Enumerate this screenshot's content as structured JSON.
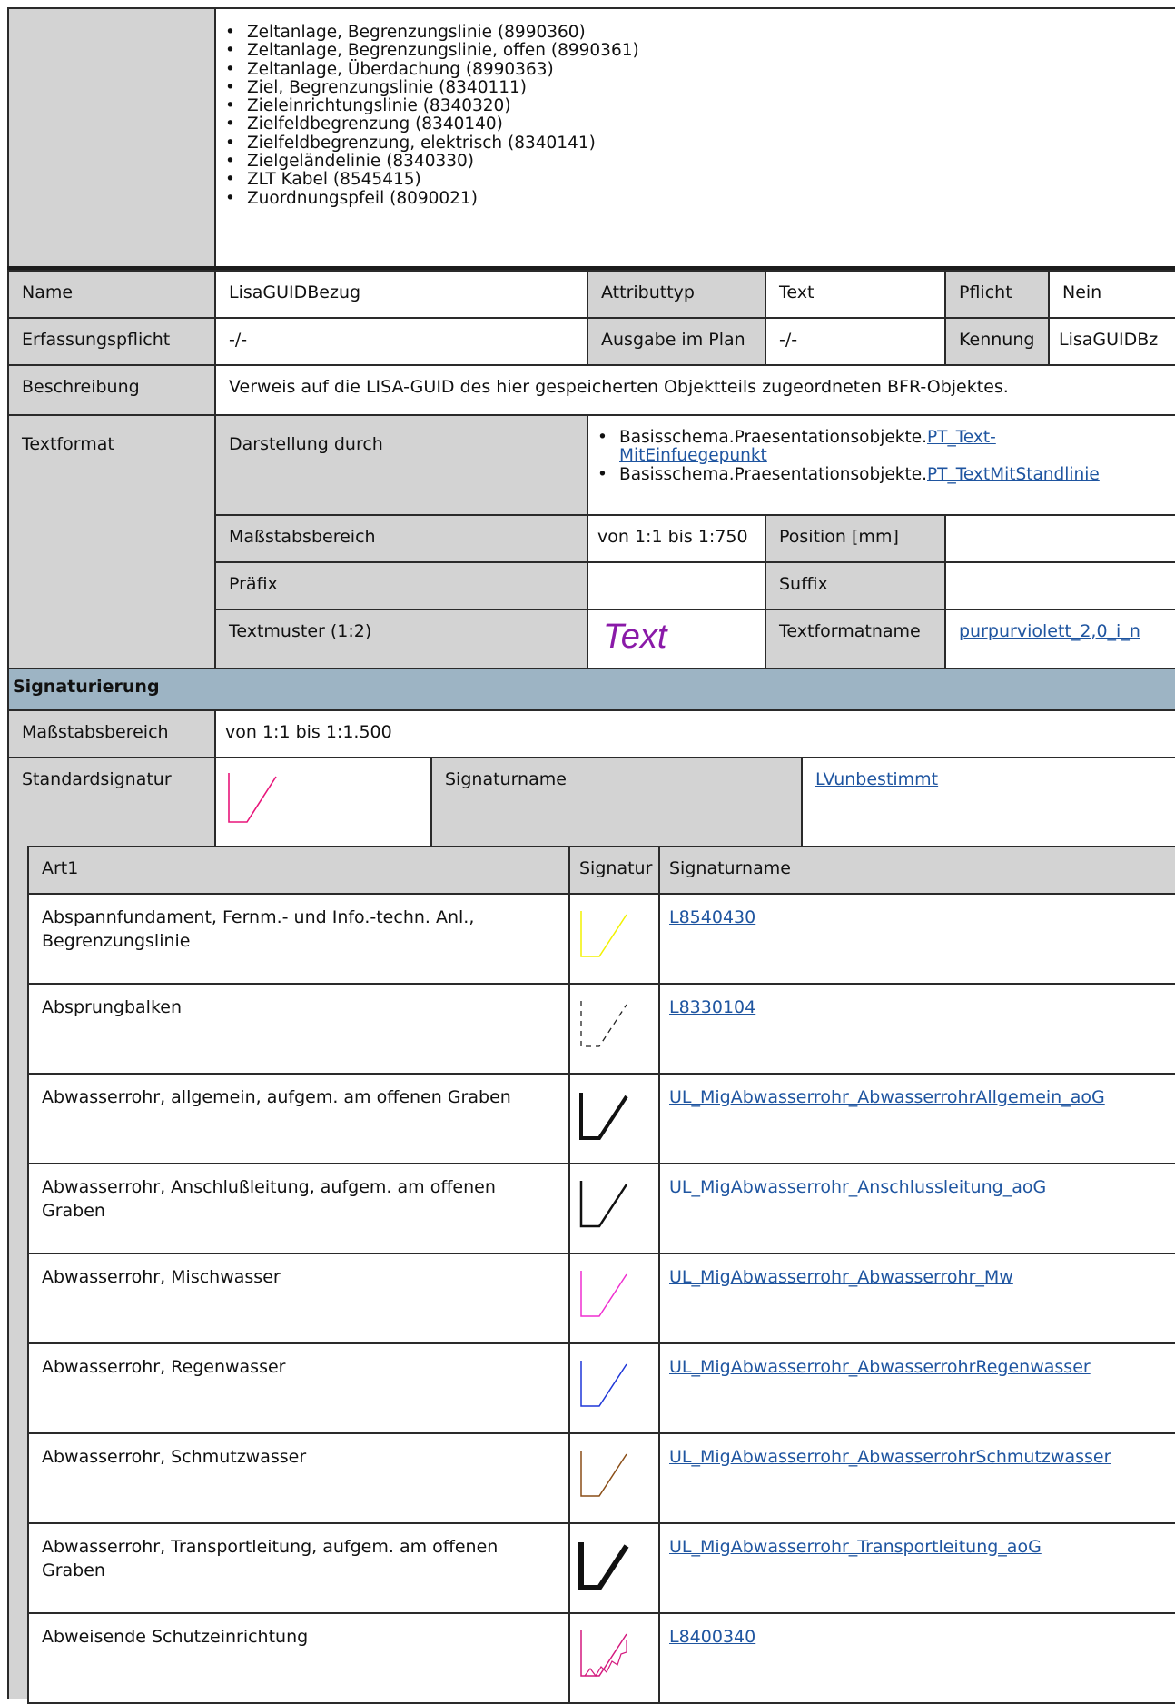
{
  "top_list": [
    "Zeltanlage, Begrenzungslinie (8990360)",
    "Zeltanlage, Begrenzungslinie, offen (8990361)",
    "Zeltanlage, Überdachung (8990363)",
    "Ziel, Begrenzungslinie (8340111)",
    "Zieleinrichtungslinie (8340320)",
    "Zielfeldbegrenzung (8340140)",
    "Zielfeldbegrenzung, elektrisch (8340141)",
    "Zielgeländelinie (8340330)",
    "ZLT Kabel (8545415)",
    "Zuordnungspfeil (8090021)"
  ],
  "attr": {
    "name_label": "Name",
    "name_value": "LisaGUIDBezug",
    "attributtyp_label": "Attributtyp",
    "attributtyp_value": "Text",
    "pflicht_label": "Pflicht",
    "pflicht_value": "Nein",
    "erfassung_label": "Erfassungspflicht",
    "erfassung_value": "-/-",
    "ausgabe_label": "Ausgabe im Plan",
    "ausgabe_value": "-/-",
    "kennung_label": "Kennung",
    "kennung_value": "LisaGUIDBz",
    "beschreibung_label": "Beschreibung",
    "beschreibung_value": "Verweis auf die LISA-GUID des hier gespeicherten Objektteils zugeordneten BFR-Objektes."
  },
  "textformat": {
    "label": "Textformat",
    "darstellung_label": "Darstellung durch",
    "darstellung_items": [
      {
        "prefix": "Basisschema.Praesentationsobjekte.",
        "link_line1": "PT_Text-",
        "link_line2": "MitEinfuegepunkt"
      },
      {
        "prefix": "Basisschema.Praesentationsobjekte.",
        "link_line1": "PT_TextMitStandlinie",
        "link_line2": ""
      }
    ],
    "massstab_label": "Maßstabsbereich",
    "massstab_value": "von 1:1 bis 1:750",
    "position_label": "Position [mm]",
    "position_value": "",
    "praefix_label": "Präfix",
    "praefix_value": "",
    "suffix_label": "Suffix",
    "suffix_value": "",
    "textmuster_label": "Textmuster (1:2)",
    "textmuster_sample": "Text",
    "textformatname_label": "Textformatname",
    "textformatname_value": "purpurviolett_2,0_i_n"
  },
  "signaturierung": {
    "header": "Signaturierung",
    "massstab_label": "Maßstabsbereich",
    "massstab_value": "von 1:1 bis 1:1.500",
    "standard_label": "Standardsignatur",
    "signaturname_label": "Signaturname",
    "signaturname_value": "LVunbestimmt",
    "standard_color": "#e8157a"
  },
  "art_table": {
    "col_art": "Art1",
    "col_signatur": "Signatur",
    "col_name": "Signaturname",
    "rows": [
      {
        "art": [
          "Abspannfundament, Fernm.- und Info.-techn. Anl.,",
          "Begrenzungslinie"
        ],
        "name": "L8540430",
        "color": "#f2f200",
        "style": "thin"
      },
      {
        "art": [
          "Absprungbalken"
        ],
        "name": "L8330104",
        "color": "#222222",
        "style": "dashed"
      },
      {
        "art": [
          "Abwasserrohr, allgemein, aufgem. am offenen Graben"
        ],
        "name": "UL_MigAbwasserrohr_AbwasserrohrAllgemein_aoG",
        "color": "#111111",
        "style": "thick"
      },
      {
        "art": [
          "Abwasserrohr, Anschlußleitung, aufgem. am offenen",
          "Graben"
        ],
        "name": "UL_MigAbwasserrohr_Anschlussleitung_aoG",
        "color": "#111111",
        "style": "medium"
      },
      {
        "art": [
          "Abwasserrohr, Mischwasser"
        ],
        "name": "UL_MigAbwasserrohr_Abwasserrohr_Mw",
        "color": "#ef2fd0",
        "style": "thin"
      },
      {
        "art": [
          "Abwasserrohr, Regenwasser"
        ],
        "name": "UL_MigAbwasserrohr_AbwasserrohrRegenwasser",
        "color": "#1f37d8",
        "style": "thin"
      },
      {
        "art": [
          "Abwasserrohr, Schmutzwasser"
        ],
        "name": "UL_MigAbwasserrohr_AbwasserrohrSchmutzwasser",
        "color": "#8a4d16",
        "style": "thin"
      },
      {
        "art": [
          "Abwasserrohr, Transportleitung, aufgem. am offenen",
          "Graben"
        ],
        "name": "UL_MigAbwasserrohr_Transportleitung_aoG",
        "color": "#111111",
        "style": "xthick"
      },
      {
        "art": [
          "Abweisende Schutzeinrichtung"
        ],
        "name": "L8400340",
        "color": "#d4197e",
        "style": "hatched"
      }
    ]
  }
}
